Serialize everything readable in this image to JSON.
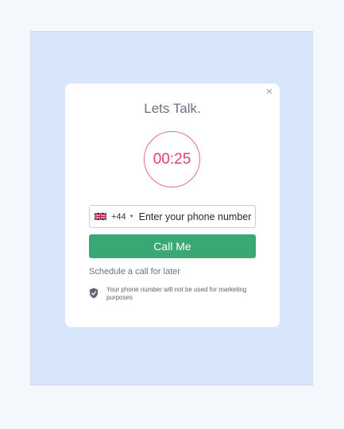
{
  "modal": {
    "close_glyph": "×",
    "title": "Lets Talk.",
    "timer": "00:25",
    "country": {
      "flag_icon": "uk-flag-icon",
      "dial_code": "+44",
      "caret": "▼"
    },
    "phone_placeholder": "Enter your phone number",
    "call_button_label": "Call Me",
    "schedule_link": "Schedule a call for later",
    "privacy_note": "Your phone number will not be used for marketing purposes"
  },
  "colors": {
    "accent_green": "#3aa873",
    "timer_pink": "#df3f7c",
    "backdrop_blue": "#d8e6fc"
  }
}
